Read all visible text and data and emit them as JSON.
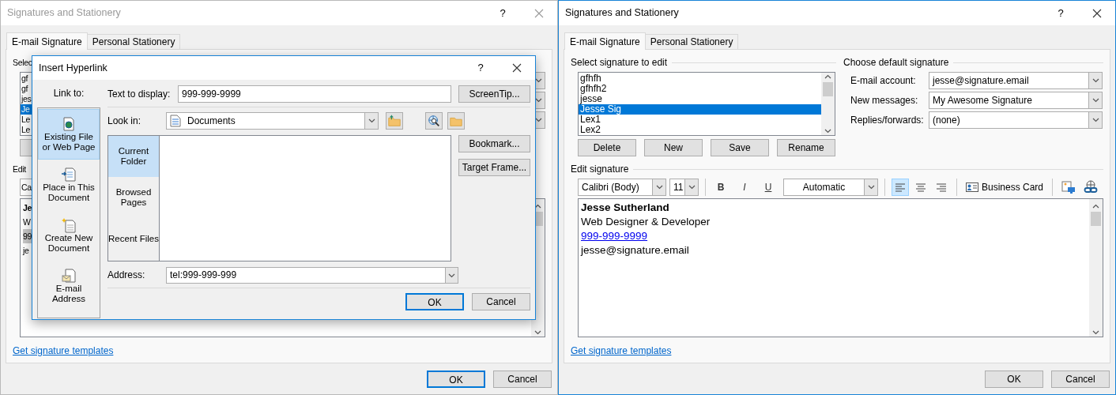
{
  "background_window": {
    "title": "Signatures and Stationery",
    "active": false,
    "help": "?",
    "tabs": [
      {
        "label": "E-mail Signature",
        "selected": true
      },
      {
        "label": "Personal Stationery",
        "selected": false
      }
    ],
    "select_label": "Selec",
    "signatures": [
      {
        "name": "gf",
        "selected": false
      },
      {
        "name": "gf",
        "selected": false
      },
      {
        "name": "jes",
        "selected": false
      },
      {
        "name": "Je",
        "selected": true
      },
      {
        "name": "Le",
        "selected": false
      },
      {
        "name": "Le",
        "selected": false
      }
    ],
    "edit_label": "Edit",
    "font": "Ca",
    "editor_lines": [
      {
        "text": "Je",
        "kind": "bold"
      },
      {
        "text": "W",
        "kind": "plain"
      },
      {
        "text": "99",
        "kind": "highlighted"
      },
      {
        "text": "je",
        "kind": "plain"
      }
    ],
    "templates_link": "Get signature templates",
    "buttons": [
      {
        "label": "OK",
        "default": true
      },
      {
        "label": "Cancel",
        "default": false
      }
    ]
  },
  "insert_hyperlink": {
    "title": "Insert Hyperlink",
    "help": "?",
    "link_to_label": "Link to:",
    "link_to": [
      {
        "label": "Existing File or Web Page",
        "kind": "file",
        "selected": true
      },
      {
        "label": "Place in This Document",
        "kind": "place",
        "selected": false
      },
      {
        "label": "Create New Document",
        "kind": "new",
        "selected": false
      },
      {
        "label": "E-mail Address",
        "kind": "email",
        "selected": false
      }
    ],
    "text_to_display": {
      "label": "Text to display:",
      "value": "999-999-9999"
    },
    "screentip": "ScreenTip...",
    "look_in": {
      "label": "Look in:",
      "value": "Documents"
    },
    "views": [
      {
        "label": "Current Folder",
        "selected": true
      },
      {
        "label": "Browsed Pages",
        "selected": false
      },
      {
        "label": "Recent Files",
        "selected": false
      }
    ],
    "side_buttons": [
      "Bookmark...",
      "Target Frame..."
    ],
    "address": {
      "label": "Address:",
      "value": "tel:999-999-999"
    },
    "buttons": [
      {
        "label": "OK",
        "default": true
      },
      {
        "label": "Cancel",
        "default": false
      }
    ]
  },
  "main_window": {
    "title": "Signatures and Stationery",
    "active": true,
    "help": "?",
    "tabs": [
      {
        "label": "E-mail Signature",
        "selected": true
      },
      {
        "label": "Personal Stationery",
        "selected": false
      }
    ],
    "select_label": "Select signature to edit",
    "signatures": [
      {
        "name": "gfhfh",
        "selected": false
      },
      {
        "name": "gfhfh2",
        "selected": false
      },
      {
        "name": "jesse",
        "selected": false
      },
      {
        "name": "Jesse Sig",
        "selected": true
      },
      {
        "name": "Lex1",
        "selected": false
      },
      {
        "name": "Lex2",
        "selected": false
      }
    ],
    "list_buttons": [
      "Delete",
      "New",
      "Save",
      "Rename"
    ],
    "default_label": "Choose default signature",
    "default_fields": [
      {
        "label": "E-mail account:",
        "value": "jesse@signature.email"
      },
      {
        "label": "New messages:",
        "value": "My Awesome Signature"
      },
      {
        "label": "Replies/forwards:",
        "value": "(none)"
      }
    ],
    "edit_label": "Edit signature",
    "toolbar": {
      "font": "Calibri (Body)",
      "size": "11",
      "bold": "B",
      "italic": "I",
      "underline": "U",
      "text_color": "Automatic",
      "align": [
        {
          "kind": "left",
          "selected": true
        },
        {
          "kind": "center",
          "selected": false
        },
        {
          "kind": "right",
          "selected": false
        }
      ],
      "business_card": "Business Card"
    },
    "editor_lines": [
      {
        "text": "Jesse Sutherland",
        "kind": "bold"
      },
      {
        "text": "Web Designer & Developer",
        "kind": "plain"
      },
      {
        "text": "999-999-9999",
        "kind": "link"
      },
      {
        "text": "jesse@signature.email",
        "kind": "plain"
      }
    ],
    "templates_link": "Get signature templates",
    "buttons": [
      {
        "label": "OK",
        "default": false
      },
      {
        "label": "Cancel",
        "default": false
      }
    ]
  }
}
